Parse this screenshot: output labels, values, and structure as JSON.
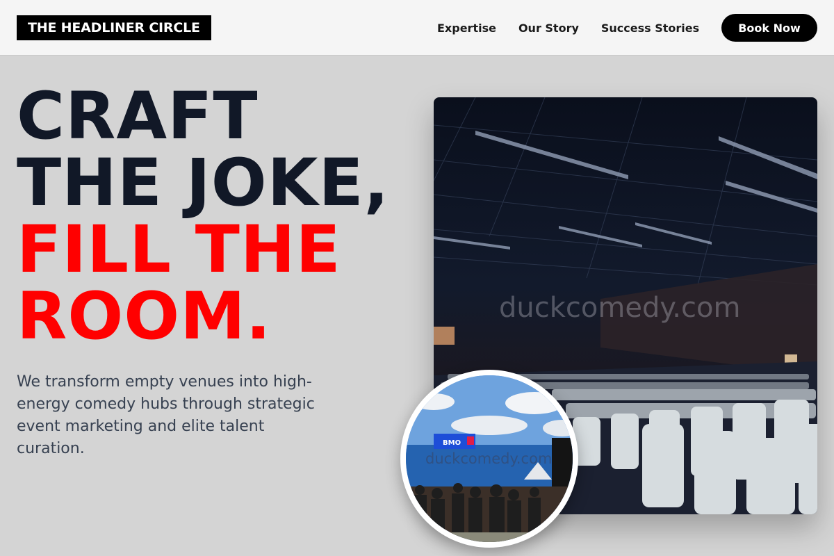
{
  "nav": {
    "logo": "THE HEADLINER CIRCLE",
    "links": [
      "Expertise",
      "Our Story",
      "Success Stories"
    ],
    "cta": "Book Now"
  },
  "hero": {
    "headline_dark": [
      "CRAFT",
      "THE JOKE,"
    ],
    "headline_red": [
      "FILL THE",
      "ROOM."
    ],
    "subtext": "We transform empty venues into high-energy comedy hubs through strategic event marketing and elite talent curation.",
    "main_watermark": "duckcomedy.com",
    "circle_watermark": "duckcomedy.com",
    "circle_sign": "BMO"
  },
  "colors": {
    "accent": "#ff0000",
    "dark_text": "#111827",
    "nav_bg": "#f5f5f5",
    "page_bg": "#d4d4d4"
  }
}
